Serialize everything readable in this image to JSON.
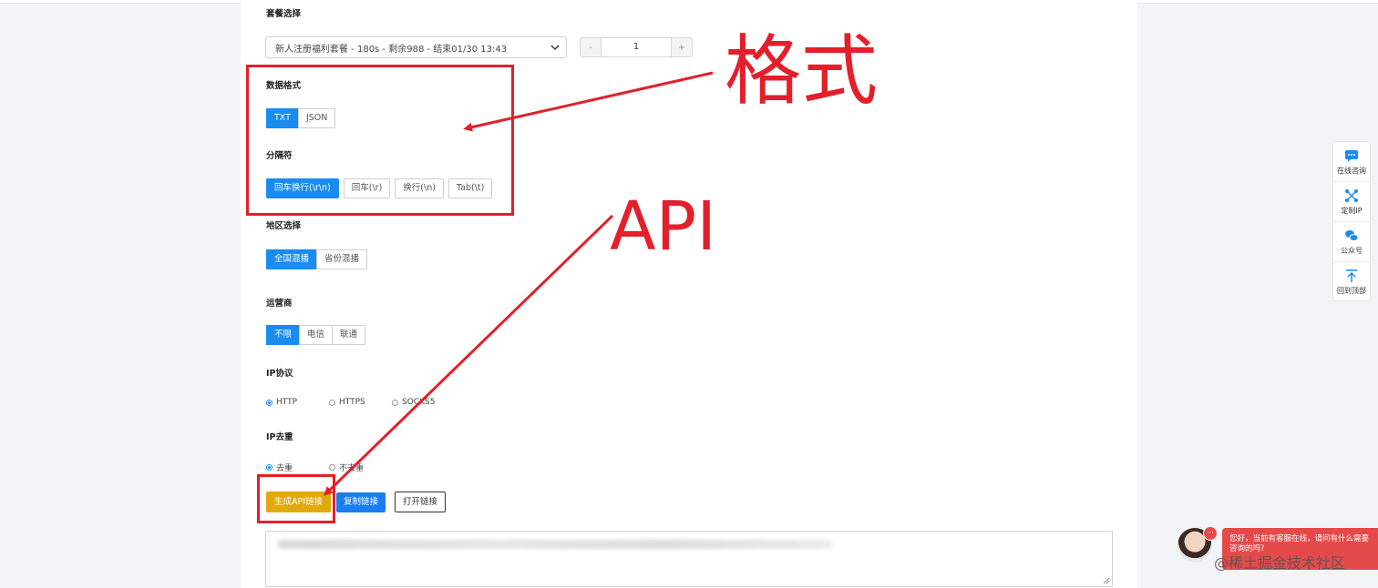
{
  "package": {
    "label": "套餐选择",
    "selected": "新人注册福利套餐 - 180s - 剩余988 - 结束01/30 13:43",
    "quantity": "1",
    "minus": "-",
    "plus": "+"
  },
  "format": {
    "label": "数据格式",
    "options": [
      {
        "label": "TXT",
        "active": true
      },
      {
        "label": "JSON",
        "active": false
      }
    ]
  },
  "separator": {
    "label": "分隔符",
    "options": [
      {
        "label": "回车换行(\\r\\n)",
        "active": true
      },
      {
        "label": "回车(\\r)",
        "active": false
      },
      {
        "label": "换行(\\n)",
        "active": false
      },
      {
        "label": "Tab(\\t)",
        "active": false
      }
    ]
  },
  "region": {
    "label": "地区选择",
    "options": [
      {
        "label": "全国混播",
        "active": true
      },
      {
        "label": "省份混播",
        "active": false
      }
    ]
  },
  "carrier": {
    "label": "运营商",
    "options": [
      {
        "label": "不限",
        "active": true
      },
      {
        "label": "电信",
        "active": false
      },
      {
        "label": "联通",
        "active": false
      }
    ]
  },
  "protocol": {
    "label": "IP协议",
    "options": [
      {
        "label": "HTTP",
        "checked": true
      },
      {
        "label": "HTTPS",
        "checked": false
      },
      {
        "label": "SOCKS5",
        "checked": false
      }
    ]
  },
  "dedupe": {
    "label": "IP去重",
    "options": [
      {
        "label": "去重",
        "checked": true
      },
      {
        "label": "不去重",
        "checked": false
      }
    ]
  },
  "actions": {
    "generate": "生成API链接",
    "copy": "复制链接",
    "open": "打开链接"
  },
  "annotations": {
    "format_text": "格式",
    "api_text": "API",
    "color": "#e2202c"
  },
  "side_panel": [
    {
      "label": "在线咨询",
      "icon": "chat-icon"
    },
    {
      "label": "定制IP",
      "icon": "network-icon"
    },
    {
      "label": "公众号",
      "icon": "wechat-icon"
    },
    {
      "label": "回到顶部",
      "icon": "arrow-up-icon"
    }
  ],
  "chat": {
    "message": "您好，当前有客服在线，请问有什么需要咨询的吗?",
    "badge": "···"
  },
  "watermark": "@稀土掘金技术社区",
  "colors": {
    "primary": "#1a8cf0",
    "generate": "#e0a90c",
    "annotation": "#e2202c"
  }
}
